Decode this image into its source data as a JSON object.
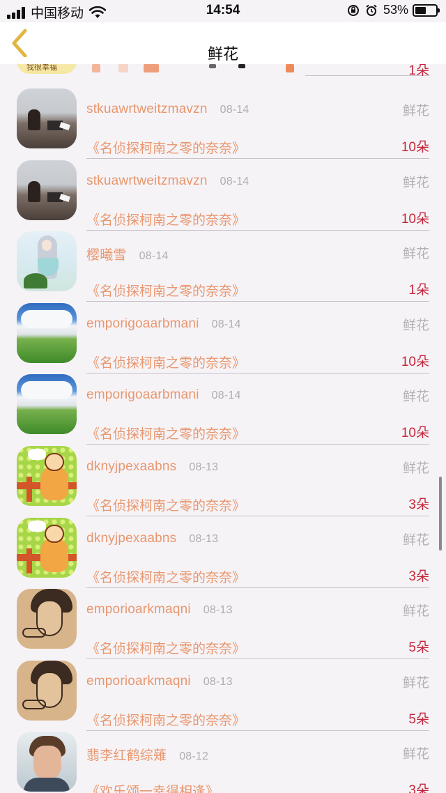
{
  "status_bar": {
    "carrier": "中国移动",
    "time": "14:54",
    "battery_percent": "53%",
    "battery_level": 0.53,
    "icons": [
      "signal-icon",
      "wifi-icon",
      "orientation-lock-icon",
      "alarm-icon",
      "battery-icon"
    ]
  },
  "nav": {
    "title": "鲜花",
    "back_icon": "chevron-left-icon"
  },
  "peek_row": {
    "count": "1朵",
    "avatar_text": "我很幸福"
  },
  "rows": [
    {
      "avatar": "sea",
      "name": "stkuawrtweitzmavzn",
      "date": "08-14",
      "type": "鲜花",
      "book": "《名侦探柯南之零的奈奈》",
      "count": "10朵"
    },
    {
      "avatar": "sea",
      "name": "stkuawrtweitzmavzn",
      "date": "08-14",
      "type": "鲜花",
      "book": "《名侦探柯南之零的奈奈》",
      "count": "10朵"
    },
    {
      "avatar": "anime",
      "name": "樱曦雪",
      "date": "08-14",
      "type": "鲜花",
      "book": "《名侦探柯南之零的奈奈》",
      "count": "1朵"
    },
    {
      "avatar": "sky",
      "name": "emporigoaarbmani",
      "date": "08-14",
      "type": "鲜花",
      "book": "《名侦探柯南之零的奈奈》",
      "count": "10朵"
    },
    {
      "avatar": "sky",
      "name": "emporigoaarbmani",
      "date": "08-14",
      "type": "鲜花",
      "book": "《名侦探柯南之零的奈奈》",
      "count": "10朵"
    },
    {
      "avatar": "cartoon",
      "name": "dknyjpexaabns",
      "date": "08-13",
      "type": "鲜花",
      "book": "《名侦探柯南之零的奈奈》",
      "count": "3朵"
    },
    {
      "avatar": "cartoon",
      "name": "dknyjpexaabns",
      "date": "08-13",
      "type": "鲜花",
      "book": "《名侦探柯南之零的奈奈》",
      "count": "3朵"
    },
    {
      "avatar": "sketch",
      "name": "emporioarkmaqni",
      "date": "08-13",
      "type": "鲜花",
      "book": "《名侦探柯南之零的奈奈》",
      "count": "5朵"
    },
    {
      "avatar": "sketch",
      "name": "emporioarkmaqni",
      "date": "08-13",
      "type": "鲜花",
      "book": "《名侦探柯南之零的奈奈》",
      "count": "5朵"
    },
    {
      "avatar": "man",
      "name": "翡李红鹤综薙",
      "date": "08-12",
      "type": "鲜花",
      "book": "《欢乐颂一幸得相逢》",
      "count": "3朵"
    }
  ],
  "colors": {
    "name": "#e8976e",
    "count": "#c5273a",
    "muted": "#b0acb0",
    "back_arrow": "#e0b640",
    "background": "#f6f3f7"
  }
}
